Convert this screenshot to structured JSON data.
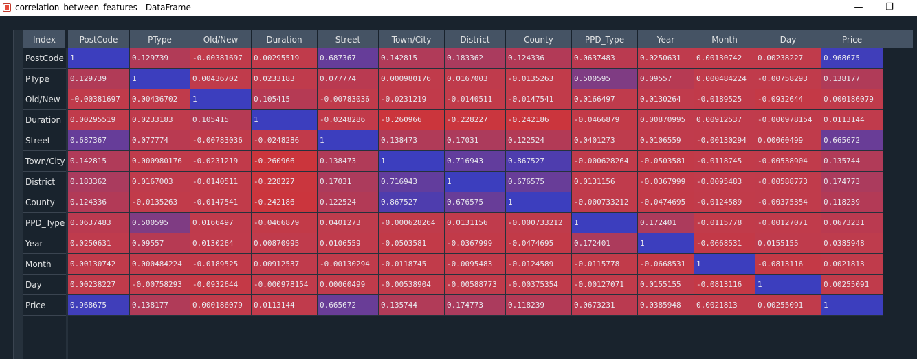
{
  "window": {
    "title": "correlation_between_features - DataFrame",
    "minimize_glyph": "—",
    "restore_glyph": "❐",
    "app_icon": "spyder-icon"
  },
  "table": {
    "index_header": "Index",
    "columns": [
      "PostCode",
      "PType",
      "Old/New",
      "Duration",
      "Street",
      "Town/City",
      "District",
      "County",
      "PPD_Type",
      "Year",
      "Month",
      "Day",
      "Price"
    ],
    "rows": [
      {
        "label": "PostCode",
        "values": [
          "1",
          "0.129739",
          "-0.00381697",
          "0.00295519",
          "0.687367",
          "0.142815",
          "0.183362",
          "0.124336",
          "0.0637483",
          "0.0250631",
          "0.00130742",
          "0.00238227",
          "0.968675"
        ]
      },
      {
        "label": "PType",
        "values": [
          "0.129739",
          "1",
          "0.00436702",
          "0.0233183",
          "0.077774",
          "0.000980176",
          "0.0167003",
          "-0.0135263",
          "0.500595",
          "0.09557",
          "0.000484224",
          "-0.00758293",
          "0.138177"
        ]
      },
      {
        "label": "Old/New",
        "values": [
          "-0.00381697",
          "0.00436702",
          "1",
          "0.105415",
          "-0.00783036",
          "-0.0231219",
          "-0.0140511",
          "-0.0147541",
          "0.0166497",
          "0.0130264",
          "-0.0189525",
          "-0.0932644",
          "0.000186079"
        ]
      },
      {
        "label": "Duration",
        "values": [
          "0.00295519",
          "0.0233183",
          "0.105415",
          "1",
          "-0.0248286",
          "-0.260966",
          "-0.228227",
          "-0.242186",
          "-0.0466879",
          "0.00870995",
          "0.00912537",
          "-0.000978154",
          "0.0113144"
        ]
      },
      {
        "label": "Street",
        "values": [
          "0.687367",
          "0.077774",
          "-0.00783036",
          "-0.0248286",
          "1",
          "0.138473",
          "0.17031",
          "0.122524",
          "0.0401273",
          "0.0106559",
          "-0.00130294",
          "0.00060499",
          "0.665672"
        ]
      },
      {
        "label": "Town/City",
        "values": [
          "0.142815",
          "0.000980176",
          "-0.0231219",
          "-0.260966",
          "0.138473",
          "1",
          "0.716943",
          "0.867527",
          "-0.000628264",
          "-0.0503581",
          "-0.0118745",
          "-0.00538904",
          "0.135744"
        ]
      },
      {
        "label": "District",
        "values": [
          "0.183362",
          "0.0167003",
          "-0.0140511",
          "-0.228227",
          "0.17031",
          "0.716943",
          "1",
          "0.676575",
          "0.0131156",
          "-0.0367999",
          "-0.0095483",
          "-0.00588773",
          "0.174773"
        ]
      },
      {
        "label": "County",
        "values": [
          "0.124336",
          "-0.0135263",
          "-0.0147541",
          "-0.242186",
          "0.122524",
          "0.867527",
          "0.676575",
          "1",
          "-0.000733212",
          "-0.0474695",
          "-0.0124589",
          "-0.00375354",
          "0.118239"
        ]
      },
      {
        "label": "PPD_Type",
        "values": [
          "0.0637483",
          "0.500595",
          "0.0166497",
          "-0.0466879",
          "0.0401273",
          "-0.000628264",
          "0.0131156",
          "-0.000733212",
          "1",
          "0.172401",
          "-0.0115778",
          "-0.00127071",
          "0.0673231"
        ]
      },
      {
        "label": "Year",
        "values": [
          "0.0250631",
          "0.09557",
          "0.0130264",
          "0.00870995",
          "0.0106559",
          "-0.0503581",
          "-0.0367999",
          "-0.0474695",
          "0.172401",
          "1",
          "-0.0668531",
          "0.0155155",
          "0.0385948"
        ]
      },
      {
        "label": "Month",
        "values": [
          "0.00130742",
          "0.000484224",
          "-0.0189525",
          "0.00912537",
          "-0.00130294",
          "-0.0118745",
          "-0.0095483",
          "-0.0124589",
          "-0.0115778",
          "-0.0668531",
          "1",
          "-0.0813116",
          "0.0021813"
        ]
      },
      {
        "label": "Day",
        "values": [
          "0.00238227",
          "-0.00758293",
          "-0.0932644",
          "-0.000978154",
          "0.00060499",
          "-0.00538904",
          "-0.00588773",
          "-0.00375354",
          "-0.00127071",
          "0.0155155",
          "-0.0813116",
          "1",
          "0.00255091"
        ]
      },
      {
        "label": "Price",
        "values": [
          "0.968675",
          "0.138177",
          "0.000186079",
          "0.0113144",
          "0.665672",
          "0.135744",
          "0.174773",
          "0.118239",
          "0.0673231",
          "0.0385948",
          "0.0021813",
          "0.00255091",
          "1"
        ]
      }
    ]
  },
  "colors": {
    "background_heatmap_high": "#3d3fbf",
    "background_heatmap_low": "#c03a48",
    "header_bg": "#455364",
    "window_bg": "#19232d"
  }
}
